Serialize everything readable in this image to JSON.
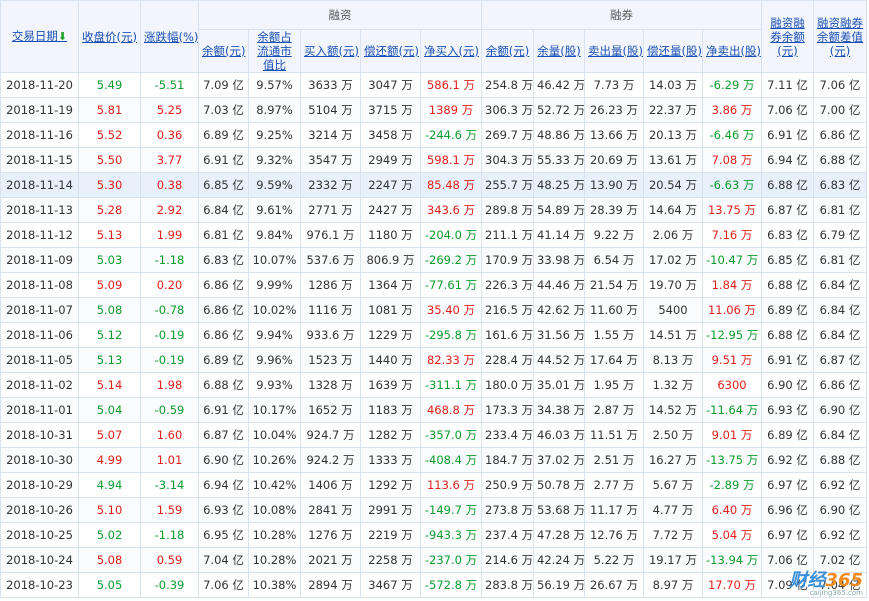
{
  "header": {
    "date": "交易日期",
    "close": "收盘价(元)",
    "change": "涨跌幅(%)",
    "rz_group": "融资",
    "rq_group": "融券",
    "rzrq_bal": "融资融券余额(元)",
    "rzrq_diff": "融资融券余额差值(元)",
    "rz_cols": [
      "余额(元)",
      "余额占流通市值比",
      "买入额(元)",
      "偿还额(元)",
      "净买入(元)"
    ],
    "rq_cols": [
      "余额(元)",
      "余量(股)",
      "卖出量(股)",
      "偿还量(股)",
      "净卖出(股)"
    ]
  },
  "rows": [
    {
      "date": "2018-11-20",
      "close": "5.49",
      "chg": "-5.51",
      "rz_bal": "7.09 亿",
      "ratio": "9.57%",
      "buy": "3633 万",
      "repay": "3047 万",
      "net": "586.1 万",
      "rq_bal": "254.8 万",
      "rq_vol": "46.42 万",
      "sell": "7.73 万",
      "rq_repay": "14.03 万",
      "net_sell": "-6.29 万",
      "total": "7.11 亿",
      "diff": "7.06 亿"
    },
    {
      "date": "2018-11-19",
      "close": "5.81",
      "chg": "5.25",
      "rz_bal": "7.03 亿",
      "ratio": "8.97%",
      "buy": "5104 万",
      "repay": "3715 万",
      "net": "1389 万",
      "rq_bal": "306.3 万",
      "rq_vol": "52.72 万",
      "sell": "26.23 万",
      "rq_repay": "22.37 万",
      "net_sell": "3.86 万",
      "total": "7.06 亿",
      "diff": "7.00 亿"
    },
    {
      "date": "2018-11-16",
      "close": "5.52",
      "chg": "0.36",
      "rz_bal": "6.89 亿",
      "ratio": "9.25%",
      "buy": "3214 万",
      "repay": "3458 万",
      "net": "-244.6 万",
      "rq_bal": "269.7 万",
      "rq_vol": "48.86 万",
      "sell": "13.66 万",
      "rq_repay": "20.13 万",
      "net_sell": "-6.46 万",
      "total": "6.91 亿",
      "diff": "6.86 亿"
    },
    {
      "date": "2018-11-15",
      "close": "5.50",
      "chg": "3.77",
      "rz_bal": "6.91 亿",
      "ratio": "9.32%",
      "buy": "3547 万",
      "repay": "2949 万",
      "net": "598.1 万",
      "rq_bal": "304.3 万",
      "rq_vol": "55.33 万",
      "sell": "20.69 万",
      "rq_repay": "13.61 万",
      "net_sell": "7.08 万",
      "total": "6.94 亿",
      "diff": "6.88 亿"
    },
    {
      "date": "2018-11-14",
      "close": "5.30",
      "chg": "0.38",
      "rz_bal": "6.85 亿",
      "ratio": "9.59%",
      "buy": "2332 万",
      "repay": "2247 万",
      "net": "85.48 万",
      "rq_bal": "255.7 万",
      "rq_vol": "48.25 万",
      "sell": "13.90 万",
      "rq_repay": "20.54 万",
      "net_sell": "-6.63 万",
      "total": "6.88 亿",
      "diff": "6.83 亿"
    },
    {
      "date": "2018-11-13",
      "close": "5.28",
      "chg": "2.92",
      "rz_bal": "6.84 亿",
      "ratio": "9.61%",
      "buy": "2771 万",
      "repay": "2427 万",
      "net": "343.6 万",
      "rq_bal": "289.8 万",
      "rq_vol": "54.89 万",
      "sell": "28.39 万",
      "rq_repay": "14.64 万",
      "net_sell": "13.75 万",
      "total": "6.87 亿",
      "diff": "6.81 亿"
    },
    {
      "date": "2018-11-12",
      "close": "5.13",
      "chg": "1.99",
      "rz_bal": "6.81 亿",
      "ratio": "9.84%",
      "buy": "976.1 万",
      "repay": "1180 万",
      "net": "-204.0 万",
      "rq_bal": "211.1 万",
      "rq_vol": "41.14 万",
      "sell": "9.22 万",
      "rq_repay": "2.06 万",
      "net_sell": "7.16 万",
      "total": "6.83 亿",
      "diff": "6.79 亿"
    },
    {
      "date": "2018-11-09",
      "close": "5.03",
      "chg": "-1.18",
      "rz_bal": "6.83 亿",
      "ratio": "10.07%",
      "buy": "537.6 万",
      "repay": "806.9 万",
      "net": "-269.2 万",
      "rq_bal": "170.9 万",
      "rq_vol": "33.98 万",
      "sell": "6.54 万",
      "rq_repay": "17.02 万",
      "net_sell": "-10.47 万",
      "total": "6.85 亿",
      "diff": "6.81 亿"
    },
    {
      "date": "2018-11-08",
      "close": "5.09",
      "chg": "0.20",
      "rz_bal": "6.86 亿",
      "ratio": "9.99%",
      "buy": "1286 万",
      "repay": "1364 万",
      "net": "-77.61 万",
      "rq_bal": "226.3 万",
      "rq_vol": "44.46 万",
      "sell": "21.54 万",
      "rq_repay": "19.70 万",
      "net_sell": "1.84 万",
      "total": "6.88 亿",
      "diff": "6.84 亿"
    },
    {
      "date": "2018-11-07",
      "close": "5.08",
      "chg": "-0.78",
      "rz_bal": "6.86 亿",
      "ratio": "10.02%",
      "buy": "1116 万",
      "repay": "1081 万",
      "net": "35.40 万",
      "rq_bal": "216.5 万",
      "rq_vol": "42.62 万",
      "sell": "11.60 万",
      "rq_repay": "5400",
      "net_sell": "11.06 万",
      "total": "6.89 亿",
      "diff": "6.84 亿"
    },
    {
      "date": "2018-11-06",
      "close": "5.12",
      "chg": "-0.19",
      "rz_bal": "6.86 亿",
      "ratio": "9.94%",
      "buy": "933.6 万",
      "repay": "1229 万",
      "net": "-295.8 万",
      "rq_bal": "161.6 万",
      "rq_vol": "31.56 万",
      "sell": "1.55 万",
      "rq_repay": "14.51 万",
      "net_sell": "-12.95 万",
      "total": "6.88 亿",
      "diff": "6.84 亿"
    },
    {
      "date": "2018-11-05",
      "close": "5.13",
      "chg": "-0.19",
      "rz_bal": "6.89 亿",
      "ratio": "9.96%",
      "buy": "1523 万",
      "repay": "1440 万",
      "net": "82.33 万",
      "rq_bal": "228.4 万",
      "rq_vol": "44.52 万",
      "sell": "17.64 万",
      "rq_repay": "8.13 万",
      "net_sell": "9.51 万",
      "total": "6.91 亿",
      "diff": "6.87 亿"
    },
    {
      "date": "2018-11-02",
      "close": "5.14",
      "chg": "1.98",
      "rz_bal": "6.88 亿",
      "ratio": "9.93%",
      "buy": "1328 万",
      "repay": "1639 万",
      "net": "-311.1 万",
      "rq_bal": "180.0 万",
      "rq_vol": "35.01 万",
      "sell": "1.95 万",
      "rq_repay": "1.32 万",
      "net_sell": "6300",
      "total": "6.90 亿",
      "diff": "6.86 亿"
    },
    {
      "date": "2018-11-01",
      "close": "5.04",
      "chg": "-0.59",
      "rz_bal": "6.91 亿",
      "ratio": "10.17%",
      "buy": "1652 万",
      "repay": "1183 万",
      "net": "468.8 万",
      "rq_bal": "173.3 万",
      "rq_vol": "34.38 万",
      "sell": "2.87 万",
      "rq_repay": "14.52 万",
      "net_sell": "-11.64 万",
      "total": "6.93 亿",
      "diff": "6.90 亿"
    },
    {
      "date": "2018-10-31",
      "close": "5.07",
      "chg": "1.60",
      "rz_bal": "6.87 亿",
      "ratio": "10.04%",
      "buy": "924.7 万",
      "repay": "1282 万",
      "net": "-357.0 万",
      "rq_bal": "233.4 万",
      "rq_vol": "46.03 万",
      "sell": "11.51 万",
      "rq_repay": "2.50 万",
      "net_sell": "9.01 万",
      "total": "6.89 亿",
      "diff": "6.84 亿"
    },
    {
      "date": "2018-10-30",
      "close": "4.99",
      "chg": "1.01",
      "rz_bal": "6.90 亿",
      "ratio": "10.26%",
      "buy": "924.2 万",
      "repay": "1333 万",
      "net": "-408.4 万",
      "rq_bal": "184.7 万",
      "rq_vol": "37.02 万",
      "sell": "2.51 万",
      "rq_repay": "16.27 万",
      "net_sell": "-13.75 万",
      "total": "6.92 亿",
      "diff": "6.88 亿"
    },
    {
      "date": "2018-10-29",
      "close": "4.94",
      "chg": "-3.14",
      "rz_bal": "6.94 亿",
      "ratio": "10.42%",
      "buy": "1406 万",
      "repay": "1292 万",
      "net": "113.6 万",
      "rq_bal": "250.9 万",
      "rq_vol": "50.78 万",
      "sell": "2.77 万",
      "rq_repay": "5.67 万",
      "net_sell": "-2.89 万",
      "total": "6.97 亿",
      "diff": "6.92 亿"
    },
    {
      "date": "2018-10-26",
      "close": "5.10",
      "chg": "1.59",
      "rz_bal": "6.93 亿",
      "ratio": "10.08%",
      "buy": "2841 万",
      "repay": "2991 万",
      "net": "-149.7 万",
      "rq_bal": "273.8 万",
      "rq_vol": "53.68 万",
      "sell": "11.17 万",
      "rq_repay": "4.77 万",
      "net_sell": "6.40 万",
      "total": "6.96 亿",
      "diff": "6.90 亿"
    },
    {
      "date": "2018-10-25",
      "close": "5.02",
      "chg": "-1.18",
      "rz_bal": "6.95 亿",
      "ratio": "10.28%",
      "buy": "1276 万",
      "repay": "2219 万",
      "net": "-943.3 万",
      "rq_bal": "237.4 万",
      "rq_vol": "47.28 万",
      "sell": "12.76 万",
      "rq_repay": "7.72 万",
      "net_sell": "5.04 万",
      "total": "6.97 亿",
      "diff": "6.92 亿"
    },
    {
      "date": "2018-10-24",
      "close": "5.08",
      "chg": "0.59",
      "rz_bal": "7.04 亿",
      "ratio": "10.28%",
      "buy": "2021 万",
      "repay": "2258 万",
      "net": "-237.0 万",
      "rq_bal": "214.6 万",
      "rq_vol": "42.24 万",
      "sell": "5.22 万",
      "rq_repay": "19.17 万",
      "net_sell": "-13.94 万",
      "total": "7.06 亿",
      "diff": "7.02 亿"
    },
    {
      "date": "2018-10-23",
      "close": "5.05",
      "chg": "-0.39",
      "rz_bal": "7.06 亿",
      "ratio": "10.38%",
      "buy": "2894 万",
      "repay": "3467 万",
      "net": "-572.8 万",
      "rq_bal": "283.8 万",
      "rq_vol": "56.19 万",
      "sell": "26.67 万",
      "rq_repay": "8.97 万",
      "net_sell": "17.70 万",
      "total": "7.09 亿",
      "diff": "7.04 亿"
    }
  ],
  "highlight_row": 4,
  "watermark": {
    "brand": "财经",
    "num": "365",
    "url": "caijing365.com"
  },
  "colors": {
    "up": "#e0201a",
    "down": "#0a9c2c",
    "header_link": "#1a4fb4"
  },
  "icons": {
    "sort": "down-arrow-icon"
  }
}
